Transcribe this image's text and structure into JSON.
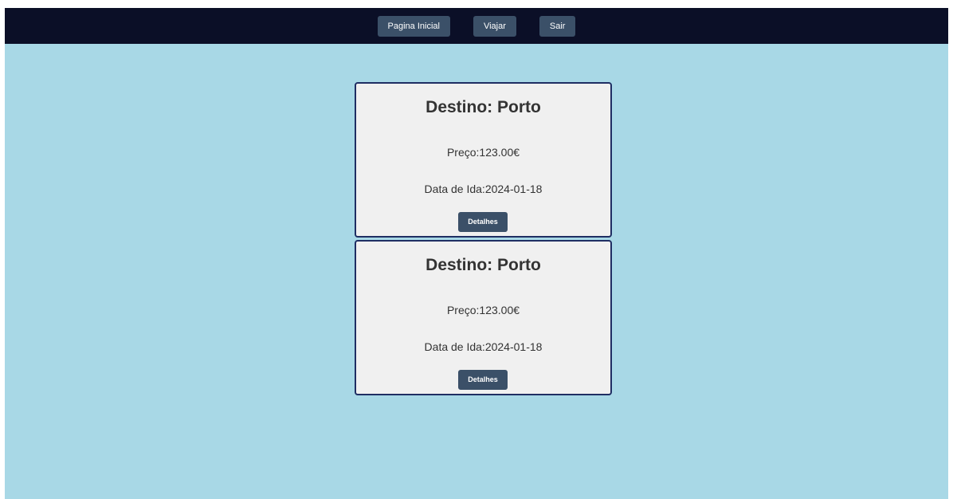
{
  "nav": {
    "items": [
      {
        "label": "Pagina Inicial"
      },
      {
        "label": "Viajar"
      },
      {
        "label": "Sair"
      }
    ]
  },
  "trips": [
    {
      "destination": "Destino: Porto",
      "price": "Preço:123.00€",
      "departure_date": "Data de Ida:2024-01-18",
      "details_label": "Detalhes"
    },
    {
      "destination": "Destino: Porto",
      "price": "Preço:123.00€",
      "departure_date": "Data de Ida:2024-01-18",
      "details_label": "Detalhes"
    }
  ],
  "colors": {
    "navbar_bg": "#0b0f27",
    "page_bg": "#a8d8e6",
    "button_bg": "#3b5068",
    "card_bg": "#f0f0f0",
    "card_border": "#1f2e63"
  }
}
